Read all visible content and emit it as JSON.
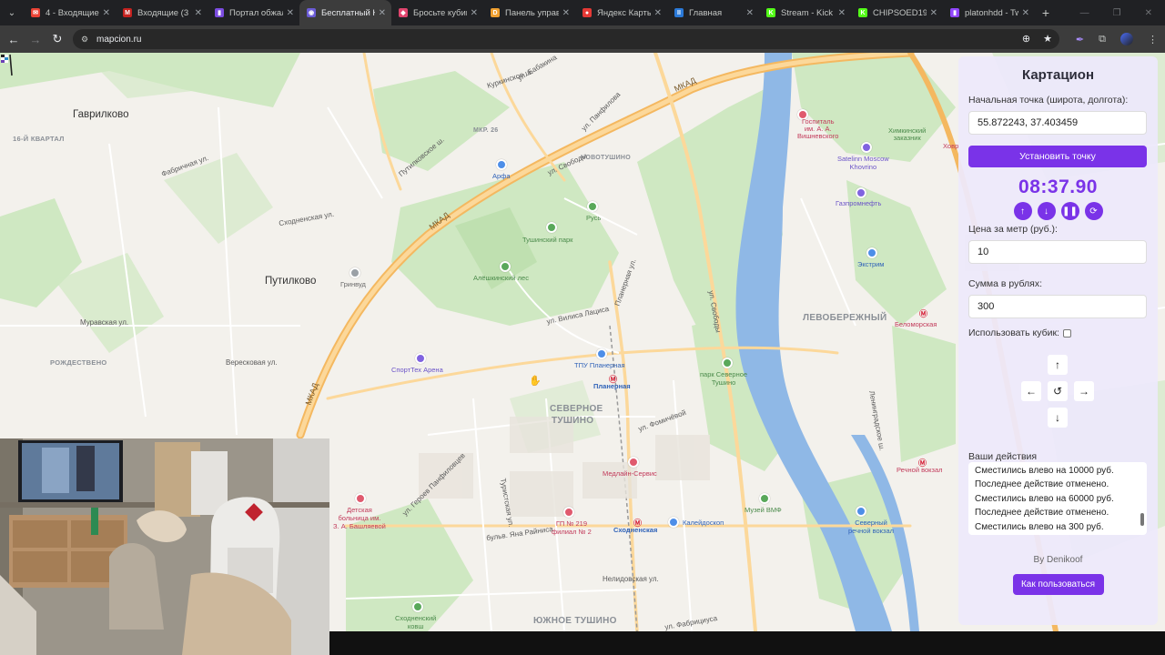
{
  "browser": {
    "tabs": [
      {
        "label": "4 - Входящие",
        "fav_color": "#ea4335",
        "fav_glyph": "✉"
      },
      {
        "label": "Входящие (3 8",
        "fav_color": "#c5221f",
        "fav_glyph": "M"
      },
      {
        "label": "Портал обжал",
        "fav_color": "#7b4ce0",
        "fav_glyph": "▮"
      },
      {
        "label": "Бесплатный К",
        "fav_color": "#6b5cd6",
        "fav_glyph": "◉",
        "active": true
      },
      {
        "label": "Бросьте кубик",
        "fav_color": "#e0456e",
        "fav_glyph": "◆"
      },
      {
        "label": "Панель управ",
        "fav_color": "#f0a030",
        "fav_glyph": "D"
      },
      {
        "label": "Яндекс Карты",
        "fav_color": "#e53935",
        "fav_glyph": "●"
      },
      {
        "label": "Главная",
        "fav_color": "#2a79d8",
        "fav_glyph": "II"
      },
      {
        "label": "Stream - Kick",
        "fav_color": "#53fc18",
        "fav_glyph": "K"
      },
      {
        "label": "CHIPSOED196",
        "fav_color": "#53fc18",
        "fav_glyph": "K"
      },
      {
        "label": "platonhdd - Tw",
        "fav_color": "#9146ff",
        "fav_glyph": "▮"
      }
    ],
    "url": "mapcion.ru"
  },
  "map": {
    "places": {
      "gavrilkovo": "Гаврилково",
      "putilkovo": "Путилково",
      "kvartal": "16-Й КВАРТАЛ",
      "rozhdestveno": "РОЖДЕСТВЕНО",
      "mkad": "МКАД",
      "mkad2": "МКАД",
      "mkad3": "МКАД",
      "mkr26": "МКР. 26",
      "novotushino": "НОВОТУШИНО",
      "levoberezhny": "ЛЕВОБЕРЕЖНЫЙ",
      "severnoe1": "СЕВЕРНОЕ",
      "severnoe2": "ТУШИНО",
      "yuzhnoe": "ЮЖНОЕ ТУШИНО"
    },
    "streets": {
      "s1": "Куркинское ш.",
      "s2": "ул. Бабакина",
      "s3": "ул. Панфилова",
      "s4": "Путилковское ш.",
      "s5": "Сходненская ул.",
      "s6": "ул. Свободы",
      "s7": "ул. Вилиса Лациса",
      "s8": "Планерная ул.",
      "s9": "ул. Героев Панфиловцев",
      "s10": "Туристская ул.",
      "s11": "бульв. Яна Райниса",
      "s12": "ул. Фомичёвой",
      "s13": "Нелидовская ул.",
      "s14": "ул. Фабрициуса",
      "s15": "Ленинградское ш.",
      "s16": "Фабричная ул.",
      "s17": "Вересковая ул.",
      "s18": "Муравская ул."
    },
    "pois": {
      "arfa": "Арфа",
      "rus": "Русь",
      "tushpark": "Тушинский парк",
      "aleshkin": "Алёшкинский лес",
      "grinvud": "Гринвуд",
      "sporttech": "СпортТех Арена",
      "tpu": "ТПУ Планерная",
      "planernaya": "Планерная",
      "parkst": "парк Северное\nТушино",
      "medlain": "Медлайн-Сервис",
      "gp219": "ГП № 219\nфилиал № 2",
      "skhodnenskaya": "Сходненская",
      "kaleidoskop": "Калейдоскоп",
      "muzvmf": "Музей ВМФ",
      "detskaya": "Детская\nбольница им.\nЗ. А. Башляевой",
      "hospital": "Госпиталь\nим. А. А.\nВишневского",
      "khimkinsky": "Химкинский\nзаказник",
      "satelinn": "Satelinn Moscow\nKhovrino",
      "gazprom": "Газпромнефть",
      "ekstrim": "Экстрим",
      "belomorskaya": "Беломорская",
      "rechnoy": "Речной вокзал",
      "sevrech": "Северный\nречной вокзал",
      "skhodkovsh": "Сходненский\nковш",
      "khovr": "Ховр"
    }
  },
  "panel": {
    "title": "Картацион",
    "start_label": "Начальная точка (широта, долгота):",
    "start_value": "55.872243, 37.403459",
    "set_point_button": "Установить точку",
    "timer": "08:37.90",
    "price_label": "Цена за метр (руб.):",
    "price_value": "10",
    "sum_label": "Сумма в рублях:",
    "sum_value": "300",
    "cube_label": "Использовать кубик:",
    "actions_label": "Ваши действия",
    "actions": [
      "Сместились влево на 10000 руб.",
      "Последнее действие отменено.",
      "Сместились влево на 60000 руб.",
      "Последнее действие отменено.",
      "Сместились влево на 300 руб."
    ],
    "byline": "By Denikoof",
    "howto_button": "Как пользоваться"
  },
  "colors": {
    "accent": "#7a33e8",
    "map_bg": "#f3f1ec",
    "park": "#cfe8c2",
    "river": "#8fb8e6",
    "highway": "#f4b860"
  }
}
